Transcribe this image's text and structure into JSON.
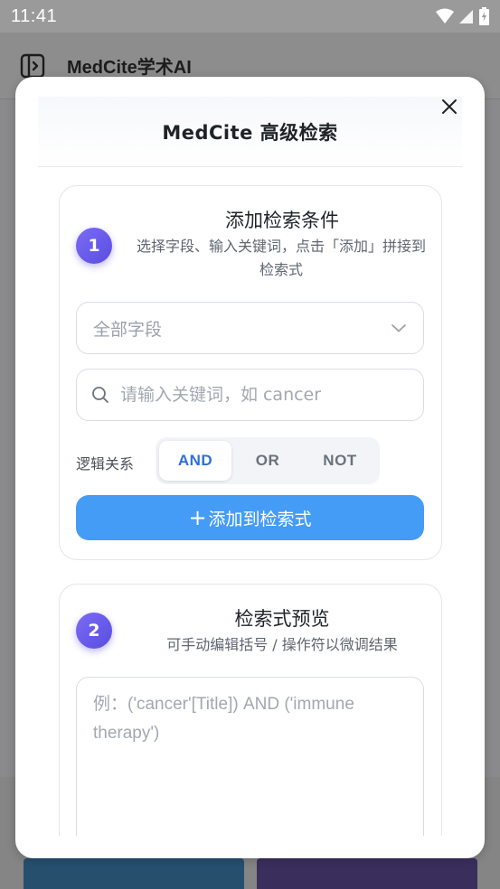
{
  "status_bar": {
    "time": "11:41"
  },
  "app": {
    "title": "MedCite学术AI"
  },
  "modal": {
    "title": "MedCite 高级检索",
    "step1": {
      "number": "1",
      "title": "添加检索条件",
      "subtitle": "选择字段、输入关键词，点击「添加」拼接到检索式",
      "field_select": {
        "value": "全部字段"
      },
      "keyword_input": {
        "value": "",
        "placeholder": "请输入关键词，如 cancer"
      },
      "logic": {
        "label": "逻辑关系",
        "options": [
          "AND",
          "OR",
          "NOT"
        ],
        "selected": "AND"
      },
      "add_button_plus": "+",
      "add_button_label": "添加到检索式"
    },
    "step2": {
      "number": "2",
      "title": "检索式预览",
      "subtitle": "可手动编辑括号 / 操作符以微调结果",
      "query_textarea": {
        "value": "",
        "placeholder": "例：('cancer'[Title]) AND ('immune therapy')"
      }
    }
  },
  "colors": {
    "accent_blue": "#449cf7",
    "active_text": "#2f6ed8",
    "badge_purple": "#6b5cf0"
  },
  "icons": {
    "sidebar_toggle": "sidebar-toggle-icon",
    "close": "close-icon",
    "search": "search-icon",
    "chevron": "chevron-down-icon",
    "wifi": "wifi-icon",
    "signal": "signal-icon",
    "battery": "battery-icon"
  }
}
